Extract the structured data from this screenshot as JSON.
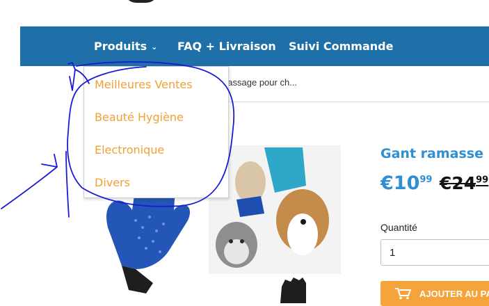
{
  "nav": {
    "items": [
      {
        "label": "Produits",
        "has_dropdown": true
      },
      {
        "label": "FAQ + Livraison"
      },
      {
        "label": "Suivi Commande"
      }
    ]
  },
  "dropdown": {
    "items": [
      "Meilleures Ventes",
      "Beauté Hygiène",
      "Electronique",
      "Divers"
    ]
  },
  "breadcrumb": {
    "text": "et massage pour ch..."
  },
  "product": {
    "title": "Gant ramasse po",
    "price_current": "€10",
    "price_current_cents": "99",
    "price_old": "€24",
    "price_old_cents": "99",
    "quantity_label": "Quantité",
    "quantity_value": "1",
    "add_to_cart_label": "AJOUTER AU PA"
  },
  "colors": {
    "nav_bg": "#1f6fa8",
    "accent_blue": "#2f8fd1",
    "dropdown_text": "#f0a035",
    "button_orange": "#f4a43a",
    "annotation_ink": "#1a1ad6"
  }
}
